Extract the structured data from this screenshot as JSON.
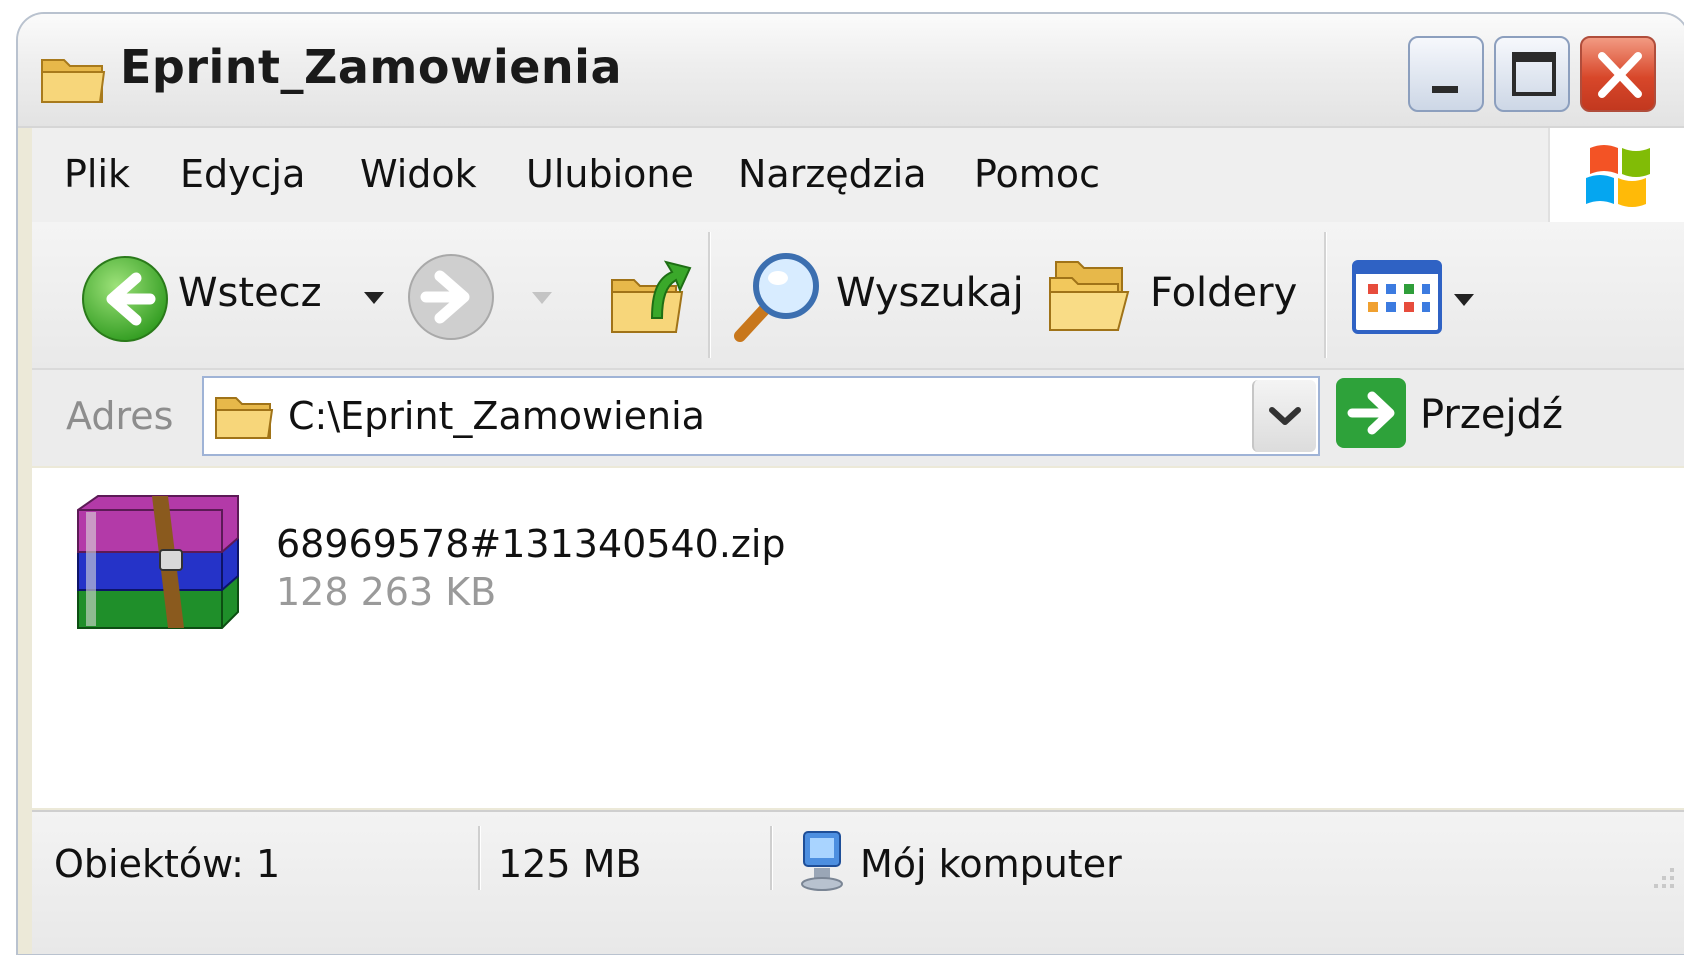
{
  "window": {
    "title": "Eprint_Zamowienia",
    "title_icon": "folder-icon"
  },
  "menu": {
    "items": [
      "Plik",
      "Edycja",
      "Widok",
      "Ulubione",
      "Narzędzia",
      "Pomoc"
    ]
  },
  "toolbar": {
    "back_label": "Wstecz",
    "search_label": "Wyszukaj",
    "folders_label": "Foldery"
  },
  "address": {
    "label": "Adres",
    "path": "C:\\Eprint_Zamowienia",
    "go_label": "Przejdź"
  },
  "files": [
    {
      "name": "68969578#131340540.zip",
      "size": "128 263 KB",
      "icon": "winrar-archive-icon"
    }
  ],
  "status": {
    "objects": "Obiektów: 1",
    "size": "125 MB",
    "location": "Mój komputer"
  }
}
